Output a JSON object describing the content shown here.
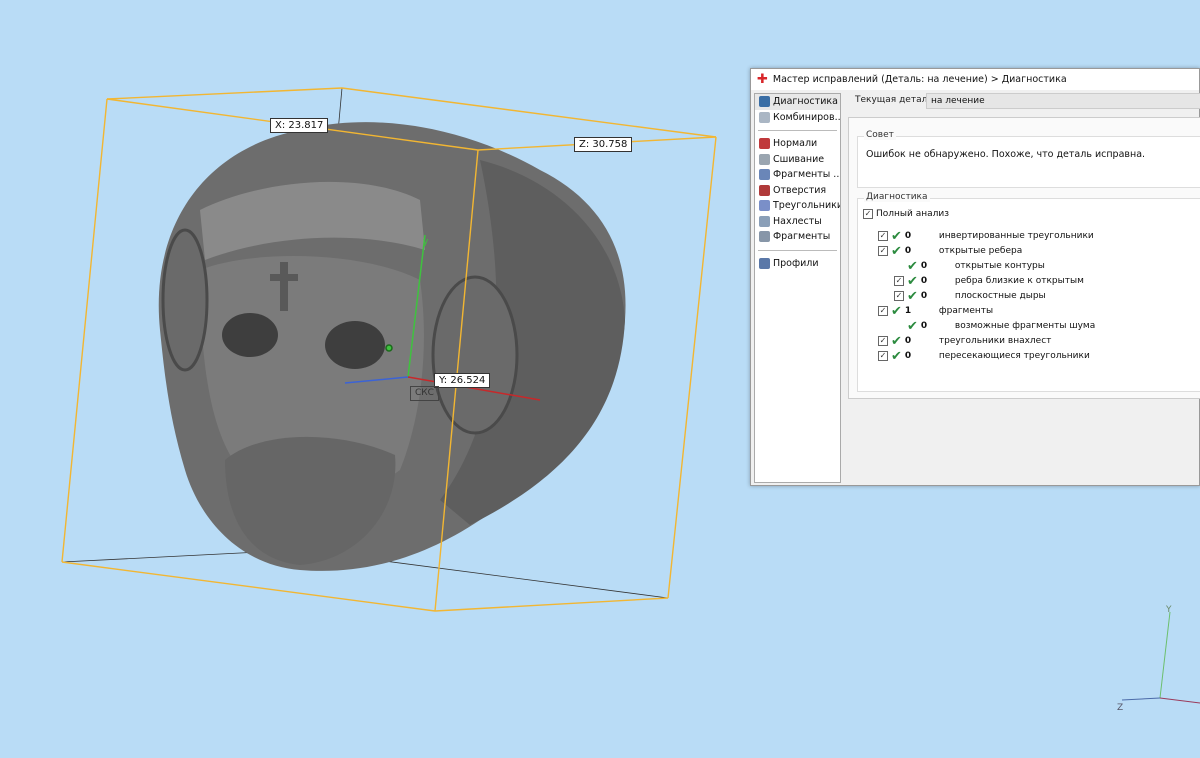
{
  "viewport": {
    "dim_x": "X: 23.817",
    "dim_y": "Y: 26.524",
    "dim_z": "Z: 30.758",
    "wcs_label": "СКС",
    "axis_y": "Y",
    "axis_z": "Z",
    "bbox_color": "#f2b632",
    "background": "#b9dcf6"
  },
  "dialog": {
    "title": "Мастер исправлений (Деталь: на лечение) > Диагностика",
    "current_part_label": "Текущая деталь:",
    "current_part_value": "на лечение",
    "nav": [
      {
        "label": "Диагностика",
        "icon": "magnifier-icon"
      },
      {
        "label": "Комбиниров...",
        "icon": "cube-icon"
      },
      {
        "label": "Нормали",
        "icon": "normals-icon"
      },
      {
        "label": "Сшивание",
        "icon": "stitch-icon"
      },
      {
        "label": "Фрагменты ...",
        "icon": "fragments-icon"
      },
      {
        "label": "Отверстия",
        "icon": "holes-icon"
      },
      {
        "label": "Треугольники",
        "icon": "triangles-icon"
      },
      {
        "label": "Нахлесты",
        "icon": "overlaps-icon"
      },
      {
        "label": "Фрагменты",
        "icon": "shells-icon"
      },
      {
        "label": "Профили",
        "icon": "document-icon"
      }
    ],
    "advice_title": "Совет",
    "advice_text": "Ошибок не обнаружено. Похоже, что деталь исправна.",
    "diag_title": "Диагностика",
    "full_analysis": "Полный анализ",
    "checks": [
      {
        "count": "0",
        "label": "инвертированные треугольники",
        "level": 0,
        "checkbox": true
      },
      {
        "count": "0",
        "label": "открытые ребера",
        "level": 0,
        "checkbox": true
      },
      {
        "count": "0",
        "label": "открытые контуры",
        "level": 1,
        "checkbox": false
      },
      {
        "count": "0",
        "label": "ребра близкие к открытым",
        "level": 1,
        "checkbox": true
      },
      {
        "count": "0",
        "label": "плоскостные дыры",
        "level": 1,
        "checkbox": true
      },
      {
        "count": "1",
        "label": "фрагменты",
        "level": 0,
        "checkbox": true
      },
      {
        "count": "0",
        "label": "возможные фрагменты шума",
        "level": 1,
        "checkbox": false
      },
      {
        "count": "0",
        "label": "треугольники внахлест",
        "level": 0,
        "checkbox": true
      },
      {
        "count": "0",
        "label": "пересекающиеся треугольники",
        "level": 0,
        "checkbox": true
      }
    ]
  }
}
